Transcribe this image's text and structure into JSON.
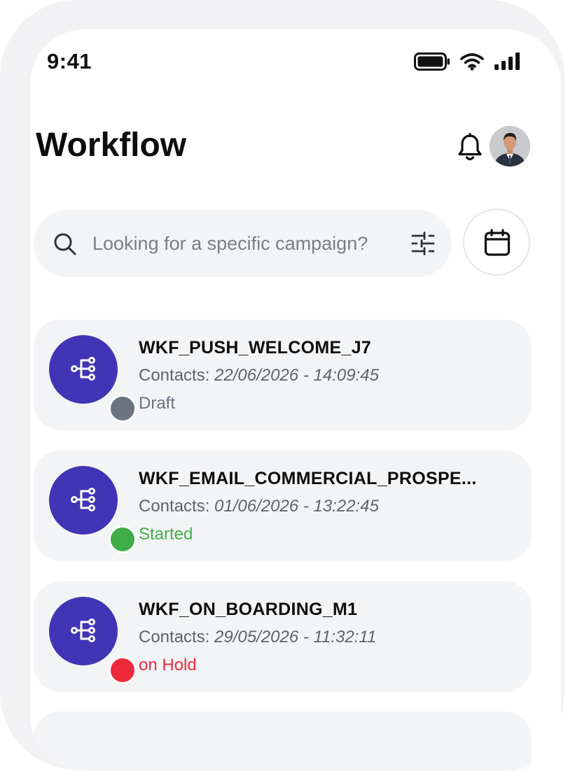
{
  "status_bar": {
    "time": "9:41",
    "icons": [
      "battery-icon",
      "wifi-icon",
      "cellular-signal-icon"
    ]
  },
  "header": {
    "title": "Workflow",
    "icons": [
      "bell-icon",
      "user-avatar"
    ]
  },
  "search": {
    "placeholder": "Looking for a specific campaign?",
    "value": "",
    "icons": [
      "search-icon",
      "filter-sliders-icon",
      "calendar-icon"
    ]
  },
  "colors": {
    "accent": "#4035b5",
    "card_bg": "#f3f4f6",
    "draft": "#6b7280",
    "started": "#3fae49",
    "on_hold": "#ee2a3a"
  },
  "workflows": [
    {
      "name": "WKF_PUSH_WELCOME_J7",
      "contacts_label": "Contacts: ",
      "contacts_date": "22/06/2026 - 14:09:45",
      "status": "Draft",
      "status_color": "#6b7280",
      "icon": "workflow-tree-icon"
    },
    {
      "name": "WKF_EMAIL_COMMERCIAL_PROSPE...",
      "contacts_label": "Contacts: ",
      "contacts_date": "01/06/2026 - 13:22:45",
      "status": "Started",
      "status_color": "#3fae49",
      "icon": "workflow-tree-icon"
    },
    {
      "name": "WKF_ON_BOARDING_M1",
      "contacts_label": "Contacts: ",
      "contacts_date": "29/05/2026 - 11:32:11",
      "status": "on Hold",
      "status_color": "#ee2a3a",
      "icon": "workflow-tree-icon"
    }
  ]
}
